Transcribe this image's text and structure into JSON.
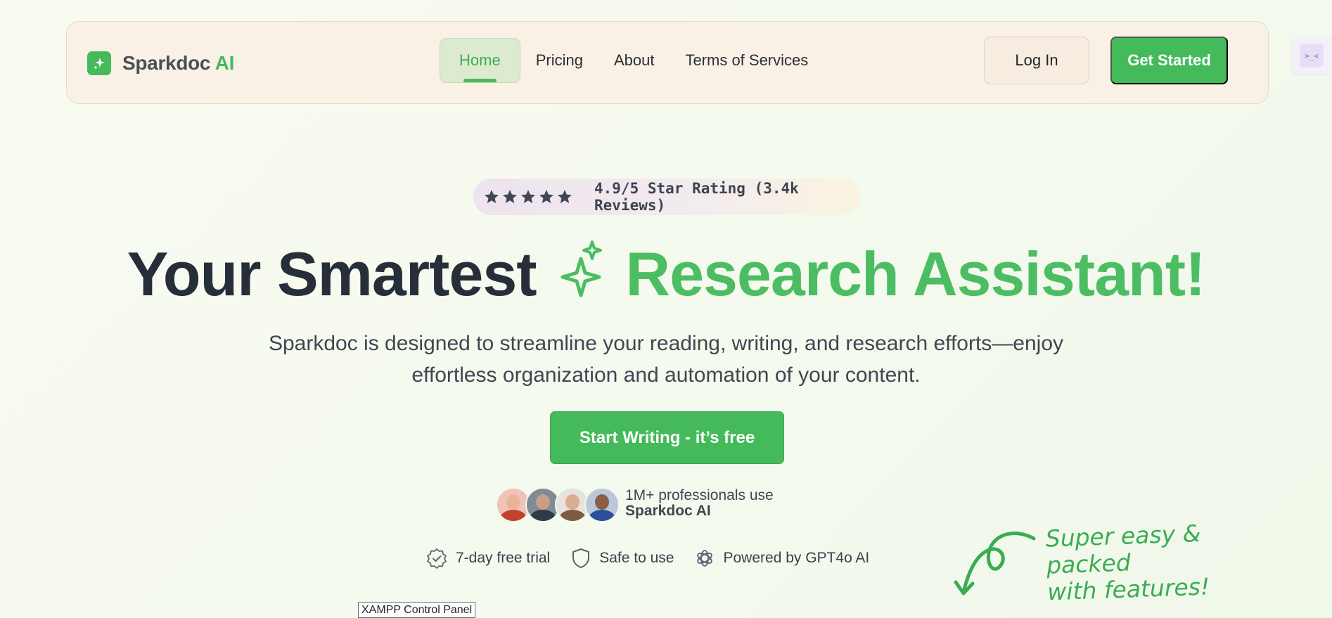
{
  "brand": {
    "name": "Sparkdoc",
    "suffix": " AI",
    "accent": "#44ba5b"
  },
  "nav": {
    "items": [
      {
        "label": "Home",
        "active": true
      },
      {
        "label": "Pricing",
        "active": false
      },
      {
        "label": "About",
        "active": false
      },
      {
        "label": "Terms of Services",
        "active": false
      }
    ],
    "login": "Log In",
    "get_started": "Get Started"
  },
  "side_widget": {
    "glyph": ">_<"
  },
  "rating": {
    "stars": 5,
    "text": "4.9/5 Star Rating (3.4k Reviews)"
  },
  "hero": {
    "title_dark": "Your Smartest",
    "title_green": "Research Assistant!",
    "subtitle": "Sparkdoc is designed to streamline your reading, writing, and research efforts—enjoy effortless organization and automation of your content.",
    "cta": "Start Writing - it’s free"
  },
  "social_proof": {
    "line1": "1M+ professionals use",
    "line2": "Sparkdoc AI",
    "avatar_count": 4
  },
  "features": [
    {
      "icon": "badge-check-icon",
      "label": "7-day free trial"
    },
    {
      "icon": "shield-icon",
      "label": "Safe to use"
    },
    {
      "icon": "openai-icon",
      "label": "Powered by GPT4o AI"
    }
  ],
  "annotation": {
    "line1": "Super easy & packed",
    "line2": "with features!"
  },
  "taskbar_tooltip": "XAMPP Control Panel"
}
